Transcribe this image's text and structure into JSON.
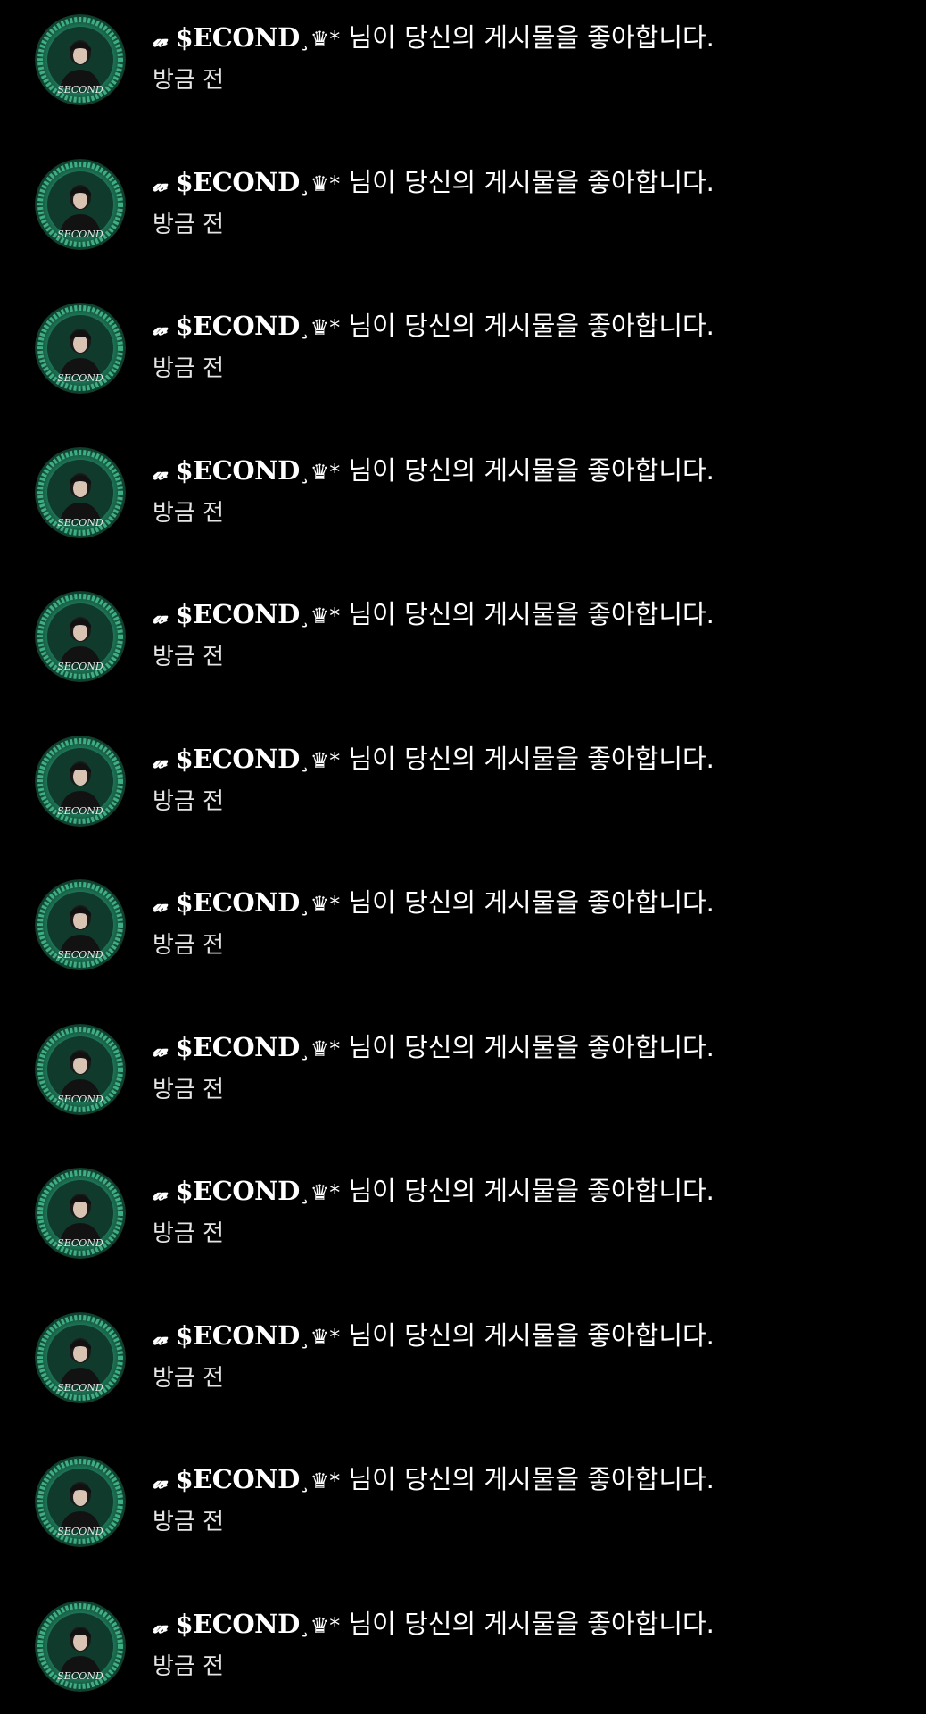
{
  "notifications": [
    {
      "name_prefix": "𝔀",
      "name": "$ECOND",
      "name_suffix": "¸♛*",
      "message": " 님이 당신의 게시물을 좋아합니다.",
      "time": "방금 전"
    },
    {
      "name_prefix": "𝔀",
      "name": "$ECOND",
      "name_suffix": "¸♛*",
      "message": " 님이 당신의 게시물을 좋아합니다.",
      "time": "방금 전"
    },
    {
      "name_prefix": "𝔀",
      "name": "$ECOND",
      "name_suffix": "¸♛*",
      "message": " 님이 당신의 게시물을 좋아합니다.",
      "time": "방금 전"
    },
    {
      "name_prefix": "𝔀",
      "name": "$ECOND",
      "name_suffix": "¸♛*",
      "message": " 님이 당신의 게시물을 좋아합니다.",
      "time": "방금 전"
    },
    {
      "name_prefix": "𝔀",
      "name": "$ECOND",
      "name_suffix": "¸♛*",
      "message": " 님이 당신의 게시물을 좋아합니다.",
      "time": "방금 전"
    },
    {
      "name_prefix": "𝔀",
      "name": "$ECOND",
      "name_suffix": "¸♛*",
      "message": " 님이 당신의 게시물을 좋아합니다.",
      "time": "방금 전"
    },
    {
      "name_prefix": "𝔀",
      "name": "$ECOND",
      "name_suffix": "¸♛*",
      "message": " 님이 당신의 게시물을 좋아합니다.",
      "time": "방금 전"
    },
    {
      "name_prefix": "𝔀",
      "name": "$ECOND",
      "name_suffix": "¸♛*",
      "message": " 님이 당신의 게시물을 좋아합니다.",
      "time": "방금 전"
    },
    {
      "name_prefix": "𝔀",
      "name": "$ECOND",
      "name_suffix": "¸♛*",
      "message": " 님이 당신의 게시물을 좋아합니다.",
      "time": "방금 전"
    },
    {
      "name_prefix": "𝔀",
      "name": "$ECOND",
      "name_suffix": "¸♛*",
      "message": " 님이 당신의 게시물을 좋아합니다.",
      "time": "방금 전"
    },
    {
      "name_prefix": "𝔀",
      "name": "$ECOND",
      "name_suffix": "¸♛*",
      "message": " 님이 당신의 게시물을 좋아합니다.",
      "time": "방금 전"
    },
    {
      "name_prefix": "𝔀",
      "name": "$ECOND",
      "name_suffix": "¸♛*",
      "message": " 님이 당신의 게시물을 좋아합니다.",
      "time": "방금 전"
    }
  ],
  "avatar": {
    "label": "SECOND",
    "icon": "profile-avatar-icon",
    "ring_color": "#1f7a5a",
    "inner_color": "#0f3a2c",
    "accent_color": "#3fae82"
  },
  "colors": {
    "background": "#000000",
    "text": "#ffffff",
    "time_text": "#e6e6e6"
  }
}
